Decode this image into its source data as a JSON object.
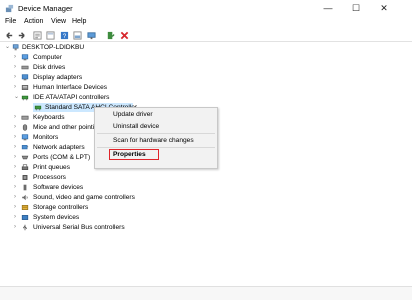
{
  "window": {
    "title": "Device Manager",
    "controls": {
      "minimize": "—",
      "maximize": "☐",
      "close": "✕"
    }
  },
  "menu": [
    "File",
    "Action",
    "View",
    "Help"
  ],
  "toolbar": [
    "back-icon",
    "forward-icon",
    "properties-icon",
    "tree-view-icon",
    "help-icon",
    "resources-icon",
    "monitor-icon",
    "update-driver-icon",
    "uninstall-icon"
  ],
  "tree": {
    "root": "DESKTOP-LDIDKBU",
    "items": [
      "Computer",
      "Disk drives",
      "Display adapters",
      "Human Interface Devices",
      "IDE ATA/ATAPI controllers",
      "Standard SATA AHCI Controller",
      "Keyboards",
      "Mice and other pointi",
      "Monitors",
      "Network adapters",
      "Ports (COM & LPT)",
      "Print queues",
      "Processors",
      "Software devices",
      "Sound, video and game controllers",
      "Storage controllers",
      "System devices",
      "Universal Serial Bus controllers"
    ]
  },
  "context_menu": {
    "items": [
      "Update driver",
      "Uninstall device",
      "Scan for hardware changes",
      "Properties"
    ]
  },
  "colors": {
    "selection": "#cce8ff",
    "highlight_box": "#e0242a",
    "delete_red": "#d7262c",
    "accent_blue": "#2b6fb8"
  }
}
